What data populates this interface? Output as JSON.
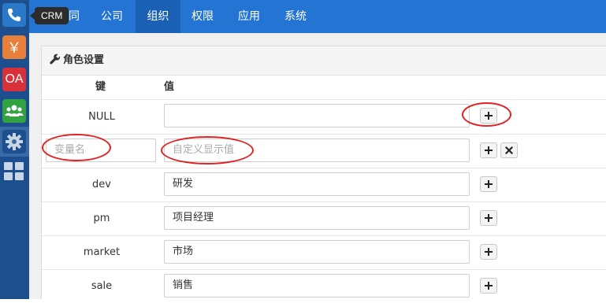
{
  "tooltip": "CRM",
  "apps": [
    {
      "name": "phone-icon"
    },
    {
      "name": "yen-icon",
      "glyph": "￥"
    },
    {
      "name": "oa-icon",
      "glyph": "OA"
    },
    {
      "name": "team-icon"
    },
    {
      "name": "gear-icon"
    },
    {
      "name": "apps-grid-icon"
    }
  ],
  "nav": [
    "...同",
    "公司",
    "组织",
    "权限",
    "应用",
    "系统"
  ],
  "nav_partial": "同",
  "panel": {
    "title": "角色设置",
    "col_key": "键",
    "col_value": "值"
  },
  "rows": [
    {
      "key": "NULL",
      "value": ""
    },
    {
      "key_placeholder": "变量名",
      "value_placeholder": "自定义显示值"
    },
    {
      "key": "dev",
      "value": "研发"
    },
    {
      "key": "pm",
      "value": "项目经理"
    },
    {
      "key": "market",
      "value": "市场"
    },
    {
      "key": "sale",
      "value": "销售"
    }
  ],
  "colors": {
    "nav_bg": "#2374d3",
    "nav_active": "#1a61b5",
    "sidebar_bg": "#1d4f8e",
    "annotation": "#e02222"
  }
}
